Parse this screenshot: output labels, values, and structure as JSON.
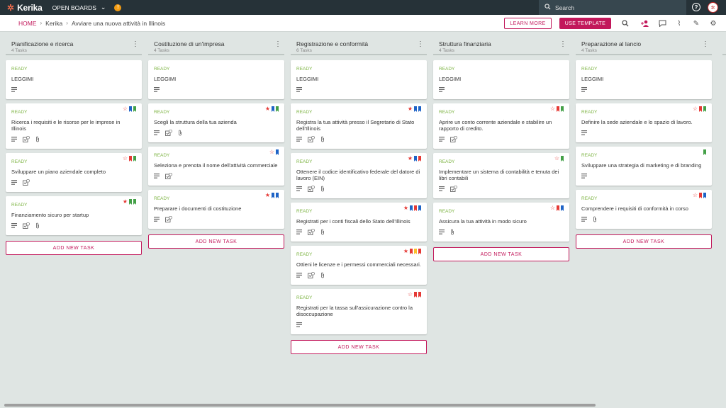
{
  "app": {
    "logo": "Kerika",
    "open_boards": "OPEN BOARDS",
    "alert_count": "!"
  },
  "search": {
    "placeholder": "Search"
  },
  "breadcrumb": {
    "home": "HOME",
    "org": "Kerika",
    "board": "Avviare una nuova attività in Illinois"
  },
  "actions": {
    "learn_more": "LEARN MORE",
    "use_template": "USE TEMPLATE"
  },
  "colors": {
    "accent": "#c2185b",
    "topbar": "#263238",
    "ready": "#7cb342",
    "red_flag": "#e53935",
    "blue_flag": "#1e63c6",
    "green_flag": "#43a047",
    "yellow_flag": "#fbc02d"
  },
  "columns": [
    {
      "title": "Pianificazione e ricerca",
      "count": "4 Tasks",
      "add_label": "ADD NEW TASK",
      "cards": [
        {
          "status": "READY",
          "title": "LEGGIMI",
          "star": "",
          "flags": [],
          "icons": [
            "desc"
          ]
        },
        {
          "status": "READY",
          "title": "Ricerca i requisiti e le risorse per le imprese in Illinois",
          "star": "empty",
          "flags": [
            "blue",
            "green"
          ],
          "icons": [
            "desc",
            "check",
            "clip"
          ]
        },
        {
          "status": "READY",
          "title": "Sviluppare un piano aziendale completo",
          "star": "empty",
          "flags": [
            "red",
            "green"
          ],
          "icons": [
            "desc",
            "check"
          ]
        },
        {
          "status": "READY",
          "title": "Finanziamento sicuro per startup",
          "star": "filled",
          "flags": [
            "green",
            "green"
          ],
          "icons": [
            "desc",
            "check",
            "clip"
          ]
        }
      ]
    },
    {
      "title": "Costituzione di un'impresa",
      "count": "4 Tasks",
      "add_label": "ADD NEW TASK",
      "cards": [
        {
          "status": "READY",
          "title": "LEGGIMI",
          "star": "",
          "flags": [],
          "icons": [
            "desc"
          ]
        },
        {
          "status": "READY",
          "title": "Scegli la struttura della tua azienda",
          "star": "filled",
          "flags": [
            "blue",
            "green"
          ],
          "icons": [
            "desc",
            "check",
            "clip"
          ]
        },
        {
          "status": "READY",
          "title": "Seleziona e prenota il nome dell'attività commerciale",
          "star": "empty",
          "flags": [
            "blue"
          ],
          "icons": [
            "desc",
            "check"
          ]
        },
        {
          "status": "READY",
          "title": "Preparare i documenti di costituzione",
          "star": "filled",
          "flags": [
            "blue",
            "blue"
          ],
          "icons": [
            "desc",
            "check"
          ]
        }
      ]
    },
    {
      "title": "Registrazione e conformità",
      "count": "6 Tasks",
      "add_label": "ADD NEW TASK",
      "cards": [
        {
          "status": "READY",
          "title": "LEGGIMI",
          "star": "",
          "flags": [],
          "icons": [
            "desc"
          ]
        },
        {
          "status": "READY",
          "title": "Registra la tua attività presso il Segretario di Stato dell'Illinois",
          "star": "filled",
          "flags": [
            "blue",
            "blue"
          ],
          "icons": [
            "desc",
            "check",
            "clip"
          ]
        },
        {
          "status": "READY",
          "title": "Ottenere il codice identificativo federale del datore di lavoro (EIN)",
          "star": "filled",
          "flags": [
            "blue",
            "red"
          ],
          "icons": [
            "desc",
            "check",
            "clip"
          ]
        },
        {
          "status": "READY",
          "title": "Registrati per i conti fiscali dello Stato dell'Illinois",
          "star": "filled",
          "flags": [
            "blue",
            "red",
            "blue"
          ],
          "icons": [
            "desc",
            "check",
            "clip"
          ]
        },
        {
          "status": "READY",
          "title": "Ottieni le licenze e i permessi commerciali necessari.",
          "star": "filled",
          "flags": [
            "red",
            "yellow",
            "red"
          ],
          "icons": [
            "desc",
            "check",
            "clip"
          ]
        },
        {
          "status": "READY",
          "title": "Registrati per la tassa sull'assicurazione contro la disoccupazione",
          "star": "empty",
          "flags": [
            "red",
            "red"
          ],
          "icons": [
            "desc"
          ]
        }
      ]
    },
    {
      "title": "Struttura finanziaria",
      "count": "4 Tasks",
      "add_label": "ADD NEW TASK",
      "cards": [
        {
          "status": "READY",
          "title": "LEGGIMI",
          "star": "",
          "flags": [],
          "icons": [
            "desc"
          ]
        },
        {
          "status": "READY",
          "title": "Aprire un conto corrente aziendale e stabilire un rapporto di credito.",
          "star": "empty",
          "flags": [
            "red",
            "green"
          ],
          "icons": [
            "desc",
            "check"
          ]
        },
        {
          "status": "READY",
          "title": "Implementare un sistema di contabilità e tenuta dei libri contabili",
          "star": "empty",
          "flags": [
            "green"
          ],
          "icons": [
            "desc",
            "check"
          ]
        },
        {
          "status": "READY",
          "title": "Assicura la tua attività in modo sicuro",
          "star": "empty",
          "flags": [
            "red",
            "blue"
          ],
          "icons": [
            "desc",
            "clip"
          ]
        }
      ]
    },
    {
      "title": "Preparazione al lancio",
      "count": "4 Tasks",
      "add_label": "ADD NEW TASK",
      "cards": [
        {
          "status": "READY",
          "title": "LEGGIMI",
          "star": "",
          "flags": [],
          "icons": [
            "desc"
          ]
        },
        {
          "status": "READY",
          "title": "Definire la sede aziendale e lo spazio di lavoro.",
          "star": "empty",
          "flags": [
            "red",
            "green"
          ],
          "icons": [
            "desc"
          ]
        },
        {
          "status": "READY",
          "title": "Sviluppare una strategia di marketing e di branding",
          "star": "",
          "flags": [
            "green"
          ],
          "icons": [
            "desc"
          ]
        },
        {
          "status": "READY",
          "title": "Comprendere i requisiti di conformità in corso",
          "star": "empty",
          "flags": [
            "red",
            "blue"
          ],
          "icons": [
            "desc",
            "clip"
          ]
        }
      ]
    }
  ]
}
